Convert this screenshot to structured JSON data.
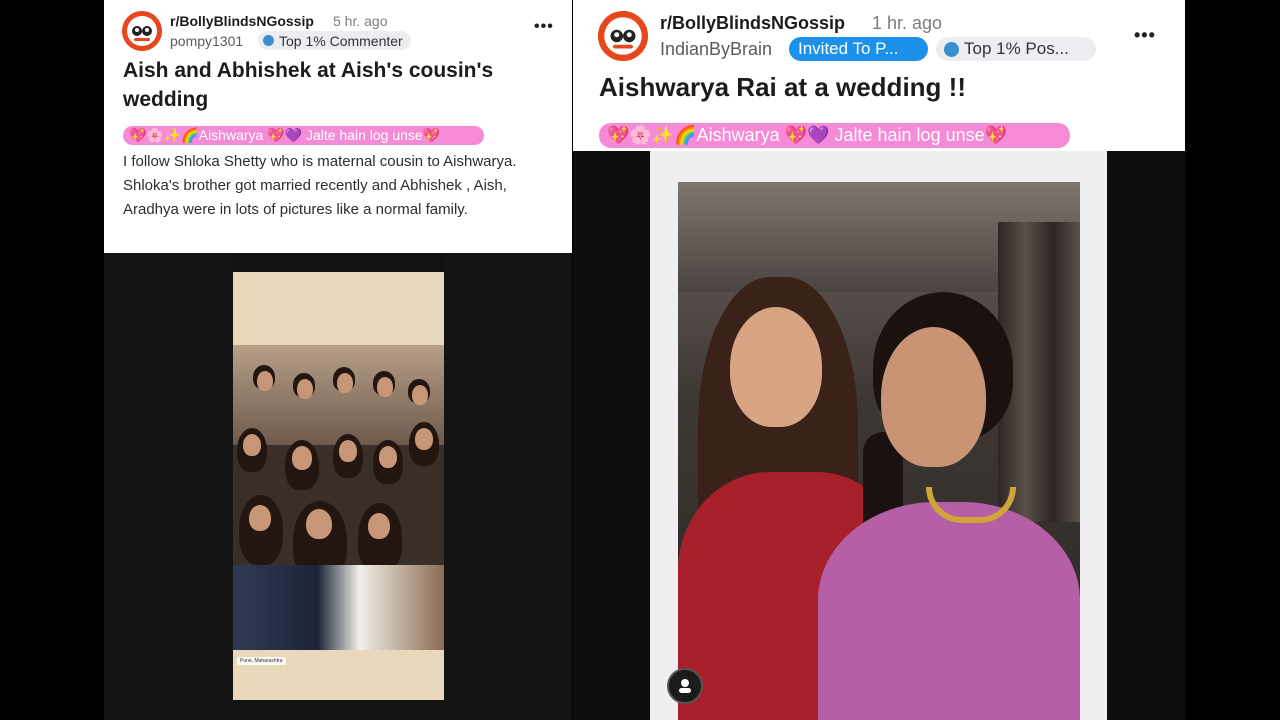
{
  "left_post": {
    "subreddit": "r/BollyBlindsNGossip",
    "time": "5 hr. ago",
    "username": "pompy1301",
    "badge": "Top 1% Commenter",
    "title": "Aish and Abhishek at Aish's cousin's wedding",
    "flair": "💖🌸✨🌈Aishwarya 💖💜 Jalte hain log unse💖",
    "body": "I follow Shloka Shetty who is maternal cousin to Aishwarya. Shloka's brother got married recently and Abhishek , Aish, Aradhya were in lots of pictures like a normal family.",
    "photo_location": "Pune, Maharashtra"
  },
  "right_post": {
    "subreddit": "r/BollyBlindsNGossip",
    "time": "1 hr. ago",
    "username": "IndianByBrain",
    "badge_invited": "Invited To P...",
    "badge_top": "Top 1% Pos...",
    "title": "Aishwarya Rai at a wedding !!",
    "flair": "💖🌸✨🌈Aishwarya 💖💜 Jalte hain log unse💖"
  },
  "icons": {
    "avatar": "bollywood-gossip-logo",
    "menu": "more-options-icon",
    "commenter_badge": "badge-icon",
    "poster_badge": "badge-icon",
    "profile": "user-profile-icon"
  },
  "colors": {
    "accent": "#e8471e",
    "badge_blue": "#1c91ea",
    "flair_pink": "#f58bd6"
  }
}
